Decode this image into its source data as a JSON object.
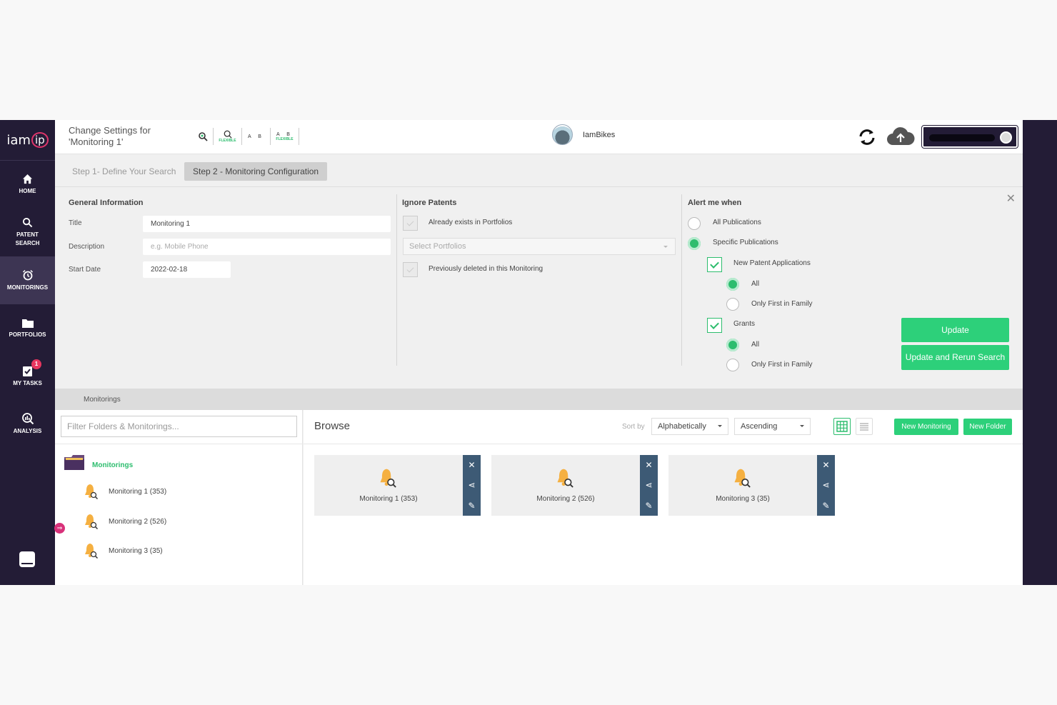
{
  "sidebar": {
    "logo_text": "iam",
    "logo_ip": "ip",
    "items": [
      {
        "label": "HOME",
        "icon": "home-icon"
      },
      {
        "label": "PATENT SEARCH",
        "icon": "search-icon"
      },
      {
        "label": "MONITORINGS",
        "icon": "alarm-clock-icon",
        "active": true
      },
      {
        "label": "PORTFOLIOS",
        "icon": "folder-icon"
      },
      {
        "label": "MY TASKS",
        "icon": "clipboard-check-icon",
        "badge": "1"
      },
      {
        "label": "ANALYSIS",
        "icon": "analysis-icon"
      }
    ]
  },
  "header": {
    "title": "Change Settings for 'Monitoring 1'",
    "tools": [
      {
        "icon": "search-refresh-icon"
      },
      {
        "icon": "search-icon",
        "sub": "FLEXIBLE"
      },
      {
        "text": "A B"
      },
      {
        "text": "A B",
        "sub": "FLEXIBLE"
      }
    ],
    "org_name": "IamBikes"
  },
  "steps": {
    "step1": "Step 1- Define Your Search",
    "step2": "Step 2 - Monitoring Configuration"
  },
  "general": {
    "heading": "General Information",
    "title_label": "Title",
    "title_value": "Monitoring 1",
    "description_label": "Description",
    "description_placeholder": "e.g. Mobile Phone",
    "start_date_label": "Start Date",
    "start_date_value": "2022-02-18"
  },
  "ignore": {
    "heading": "Ignore Patents",
    "already_exists": "Already exists in Portfolios",
    "select_placeholder": "Select Portfolios",
    "previously_deleted": "Previously deleted in this Monitoring"
  },
  "alert": {
    "heading": "Alert me when",
    "all_publications": "All Publications",
    "specific_publications": "Specific Publications",
    "new_patent_applications": "New Patent Applications",
    "npa_all": "All",
    "npa_first": "Only First in Family",
    "grants": "Grants",
    "grants_all": "All",
    "grants_first": "Only First in Family"
  },
  "buttons": {
    "update": "Update",
    "update_rerun": "Update and Rerun Search"
  },
  "monitorings_section": {
    "header": "Monitorings",
    "filter_placeholder": "Filter Folders & Monitorings...",
    "folder_label": "Monitorings",
    "items": [
      "Monitoring 1 (353)",
      "Monitoring 2 (526)",
      "Monitoring 3 (35)"
    ]
  },
  "browse": {
    "title": "Browse",
    "sort_by": "Sort by",
    "sort_value": "Alphabetically",
    "order_value": "Ascending",
    "new_monitoring": "New Monitoring",
    "new_folder": "New Folder",
    "cards": [
      "Monitoring 1 (353)",
      "Monitoring 2 (526)",
      "Monitoring 3 (35)"
    ]
  },
  "colors": {
    "sidebar": "#231c36",
    "accent_green": "#2dd07a",
    "card_side": "#3d5a75",
    "bell": "#f5b041"
  }
}
